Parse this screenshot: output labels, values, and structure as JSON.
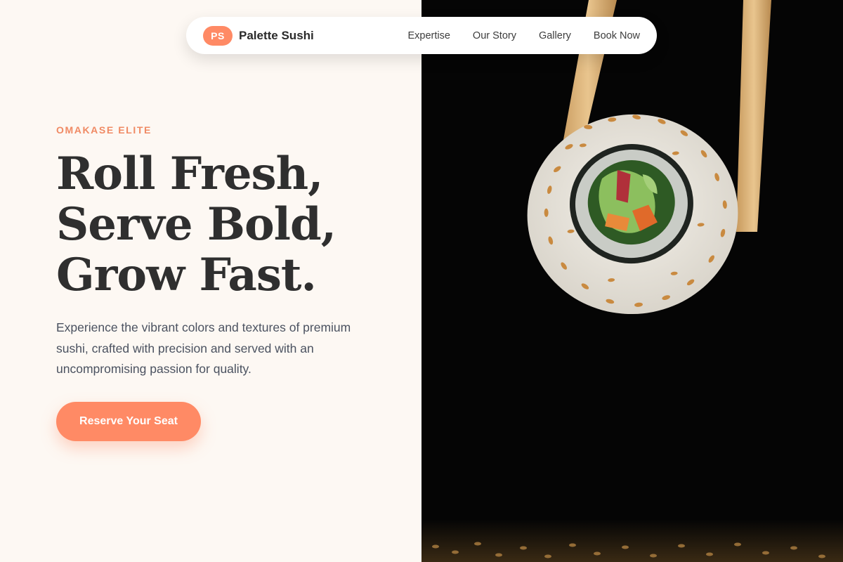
{
  "nav": {
    "logo_initials": "PS",
    "brand_name": "Palette Sushi",
    "links": [
      {
        "label": "Expertise"
      },
      {
        "label": "Our Story"
      },
      {
        "label": "Gallery"
      },
      {
        "label": "Book Now"
      }
    ]
  },
  "hero": {
    "eyebrow": "OMAKASE ELITE",
    "headline_lines": [
      "Roll Fresh,",
      "Serve Bold,",
      "Grow Fast."
    ],
    "description": "Experience the vibrant colors and textures of premium sushi, crafted with precision and served with an uncompromising passion for quality.",
    "cta_label": "Reserve Your Seat"
  },
  "image": {
    "icon": "sushi-roll-with-chopsticks"
  },
  "colors": {
    "accent": "#ff8a65",
    "eyebrow": "#f08a64",
    "background": "#fdf8f3",
    "headline": "#2f2f2f",
    "body_text": "#4b5260",
    "photo_background": "#050505"
  }
}
